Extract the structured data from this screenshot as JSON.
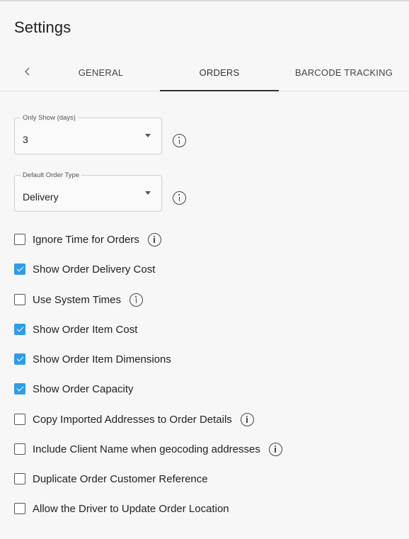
{
  "header": {
    "title": "Settings"
  },
  "tabs": [
    {
      "label": "GENERAL"
    },
    {
      "label": "ORDERS"
    },
    {
      "label": "BARCODE TRACKING"
    }
  ],
  "fields": {
    "only_show_days": {
      "label": "Only Show (days)",
      "value": "3"
    },
    "default_order_type": {
      "label": "Default Order Type",
      "value": "Delivery"
    }
  },
  "options": [
    {
      "label": "Ignore Time for Orders",
      "checked": false,
      "info": true
    },
    {
      "label": "Show Order Delivery Cost",
      "checked": true,
      "info": false
    },
    {
      "label": "Use System Times",
      "checked": false,
      "info": true
    },
    {
      "label": "Show Order Item Cost",
      "checked": true,
      "info": false
    },
    {
      "label": "Show Order Item Dimensions",
      "checked": true,
      "info": false
    },
    {
      "label": "Show Order Capacity",
      "checked": true,
      "info": false
    },
    {
      "label": "Copy Imported Addresses to Order Details",
      "checked": false,
      "info": true
    },
    {
      "label": "Include Client Name when geocoding addresses",
      "checked": false,
      "info": true
    },
    {
      "label": "Duplicate Order Customer Reference",
      "checked": false,
      "info": false
    },
    {
      "label": "Allow the Driver to Update Order Location",
      "checked": false,
      "info": false
    }
  ],
  "colors": {
    "accent": "#2f9de9",
    "background": "#f7f7f7"
  }
}
